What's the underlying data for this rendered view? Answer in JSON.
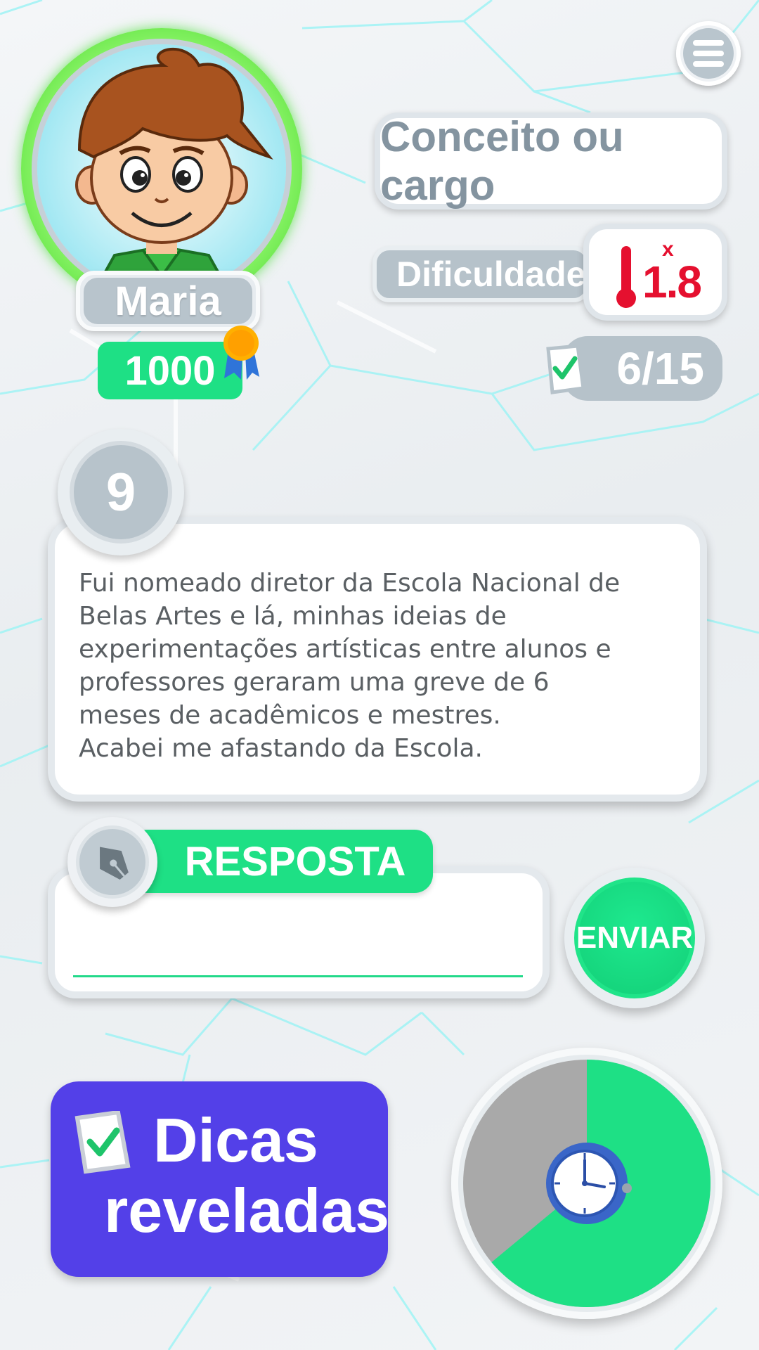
{
  "player": {
    "name": "Maria",
    "score": "1000"
  },
  "menu": {
    "icon": "hamburger-menu-icon"
  },
  "category": {
    "label": "Conceito ou cargo"
  },
  "difficulty": {
    "label": "Dificuldade",
    "multiplier_symbol": "x",
    "value": "1.8",
    "icon": "thermometer-icon",
    "color": "#e5102f"
  },
  "progress": {
    "text": "6/15",
    "icon": "checklist-icon"
  },
  "question": {
    "number": "9",
    "text": "Fui nomeado diretor da Escola Nacional de\nBelas Artes e lá, minhas ideias de\nexperimentações artísticas entre alunos e\nprofessores geraram uma greve de 6\nmeses de acadêmicos e mestres.\nAcabei me afastando da Escola."
  },
  "answer": {
    "label": "RESPOSTA",
    "value": "",
    "icon": "fountain-pen-icon"
  },
  "send_button": {
    "label": "ENVIAR"
  },
  "hints": {
    "line1": "Dicas",
    "line2": "reveladas",
    "icon": "checklist-icon"
  },
  "timer": {
    "remaining_fraction": 0.64,
    "icon": "clock-icon",
    "colors": {
      "remaining": "#1ee085",
      "elapsed": "#a9a9a9"
    }
  },
  "colors": {
    "green": "#1ee085",
    "purple": "#5340e8",
    "gray": "#b6c2ca",
    "red": "#e5102f"
  }
}
